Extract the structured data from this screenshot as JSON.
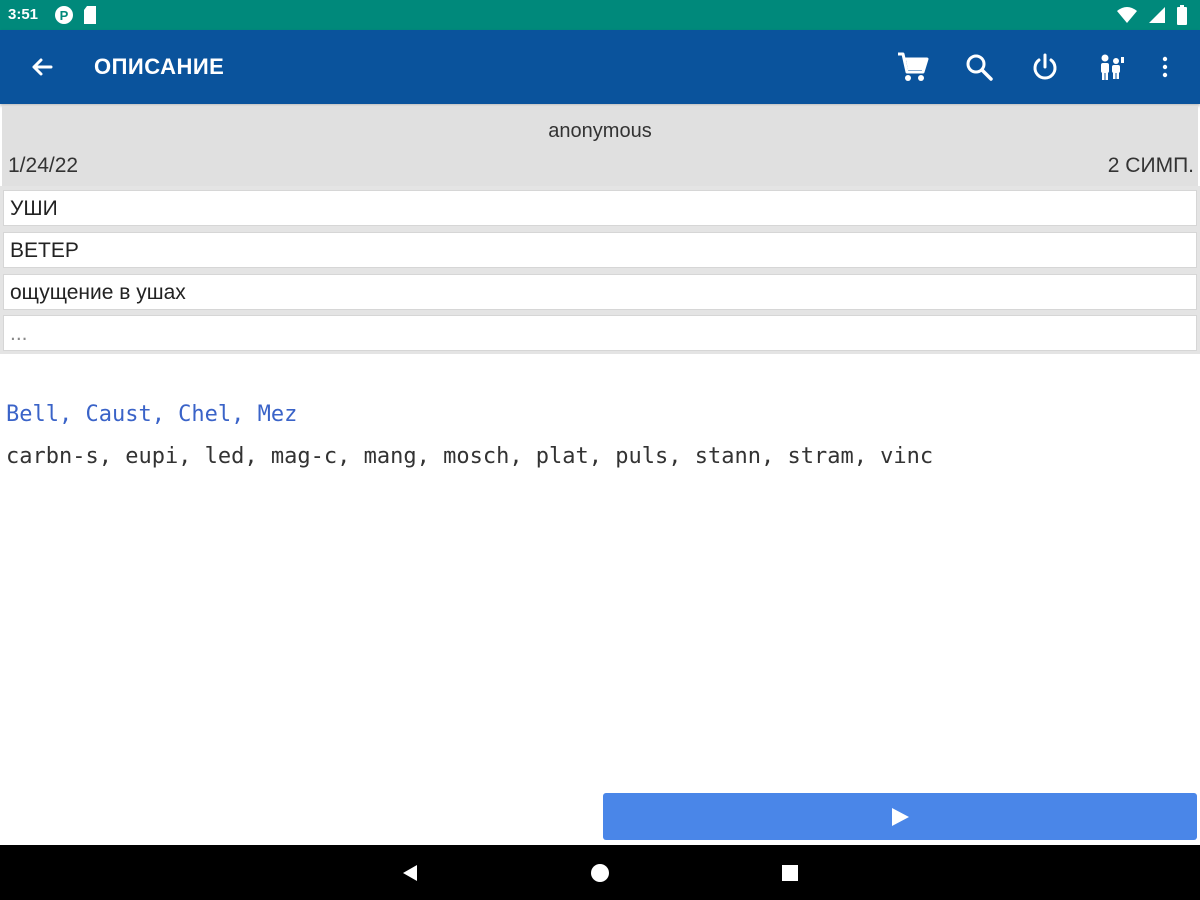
{
  "status_bar": {
    "time": "3:51",
    "icons": [
      "notification-p-icon",
      "sd-card-icon",
      "wifi-icon",
      "signal-icon",
      "battery-icon"
    ]
  },
  "app_bar": {
    "title": "ОПИСАНИЕ",
    "color": "#0a539c",
    "actions": [
      "cart-icon",
      "search-icon",
      "power-icon",
      "people-icon",
      "more-vert-icon"
    ]
  },
  "info": {
    "user": "anonymous",
    "date": "1/24/22",
    "count": "2 СИМП."
  },
  "symptoms": [
    {
      "text": "УШИ"
    },
    {
      "text": "ВЕТЕР"
    },
    {
      "text": "ощущение в ушах"
    },
    {
      "text": "..."
    }
  ],
  "remedies": {
    "primary": "Bell, Caust, Chel, Mez",
    "secondary": "carbn-s, eupi, led, mag-c, mang, mosch, plat, puls, stann, stram, vinc",
    "primary_color": "#3a63c8"
  },
  "play_button": {
    "icon": "play-icon",
    "color": "#4a86e8"
  },
  "nav_bar": {
    "icons": [
      "nav-back-icon",
      "nav-home-icon",
      "nav-recents-icon"
    ]
  }
}
